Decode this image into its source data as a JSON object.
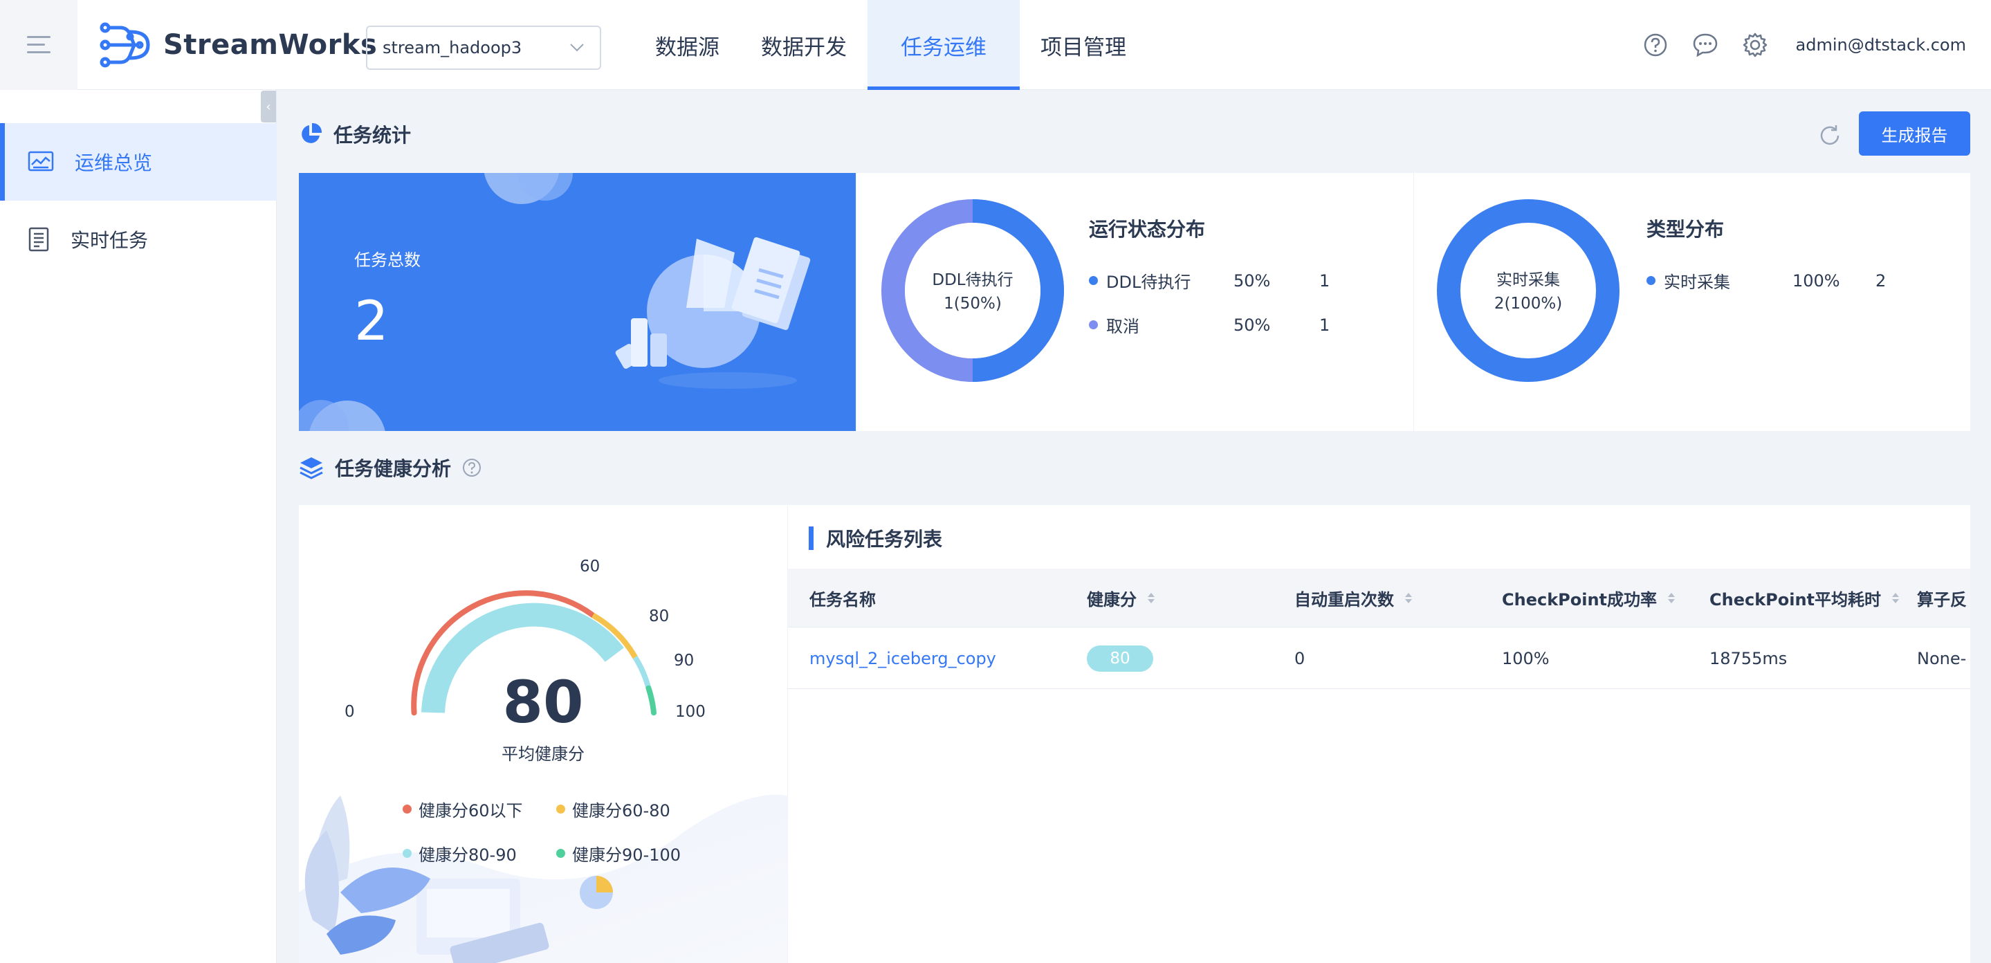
{
  "app": {
    "name": "StreamWorks"
  },
  "project_select": {
    "value": "stream_hadoop3"
  },
  "nav": [
    {
      "label": "数据源"
    },
    {
      "label": "数据开发"
    },
    {
      "label": "任务运维"
    },
    {
      "label": "项目管理"
    }
  ],
  "user": {
    "email": "admin@dtstack.com"
  },
  "sidebar": {
    "items": [
      {
        "label": "运维总览",
        "icon": "dashboard-icon"
      },
      {
        "label": "实时任务",
        "icon": "document-icon"
      }
    ]
  },
  "stats": {
    "title": "任务统计",
    "report_button": "生成报告",
    "total": {
      "label": "任务总数",
      "value": "2"
    },
    "status": {
      "title": "运行状态分布",
      "center_label": "DDL待执行",
      "center_value": "1(50%)",
      "items": [
        {
          "name": "DDL待执行",
          "percent": "50%",
          "count": "1",
          "color": "#3b7ef0"
        },
        {
          "name": "取消",
          "percent": "50%",
          "count": "1",
          "color": "#7c8ff0"
        }
      ]
    },
    "type": {
      "title": "类型分布",
      "center_label": "实时采集",
      "center_value": "2(100%)",
      "items": [
        {
          "name": "实时采集",
          "percent": "100%",
          "count": "2",
          "color": "#3b7ef0"
        }
      ]
    }
  },
  "health": {
    "title": "任务健康分析",
    "gauge": {
      "value": "80",
      "label": "平均健康分",
      "ticks": [
        "0",
        "60",
        "80",
        "90",
        "100"
      ],
      "legend": [
        {
          "label": "健康分60以下",
          "color": "#e8705c"
        },
        {
          "label": "健康分60-80",
          "color": "#f5c24c"
        },
        {
          "label": "健康分80-90",
          "color": "#9fe1eb"
        },
        {
          "label": "健康分90-100",
          "color": "#4fcf9c"
        }
      ]
    },
    "risk_list": {
      "title": "风险任务列表",
      "columns": [
        "任务名称",
        "健康分",
        "自动重启次数",
        "CheckPoint成功率",
        "CheckPoint平均耗时",
        "算子反"
      ],
      "rows": [
        {
          "name": "mysql_2_iceberg_copy",
          "score": "80",
          "restarts": "0",
          "cp_success": "100%",
          "cp_avg": "18755ms",
          "op": "None-"
        }
      ]
    }
  }
}
